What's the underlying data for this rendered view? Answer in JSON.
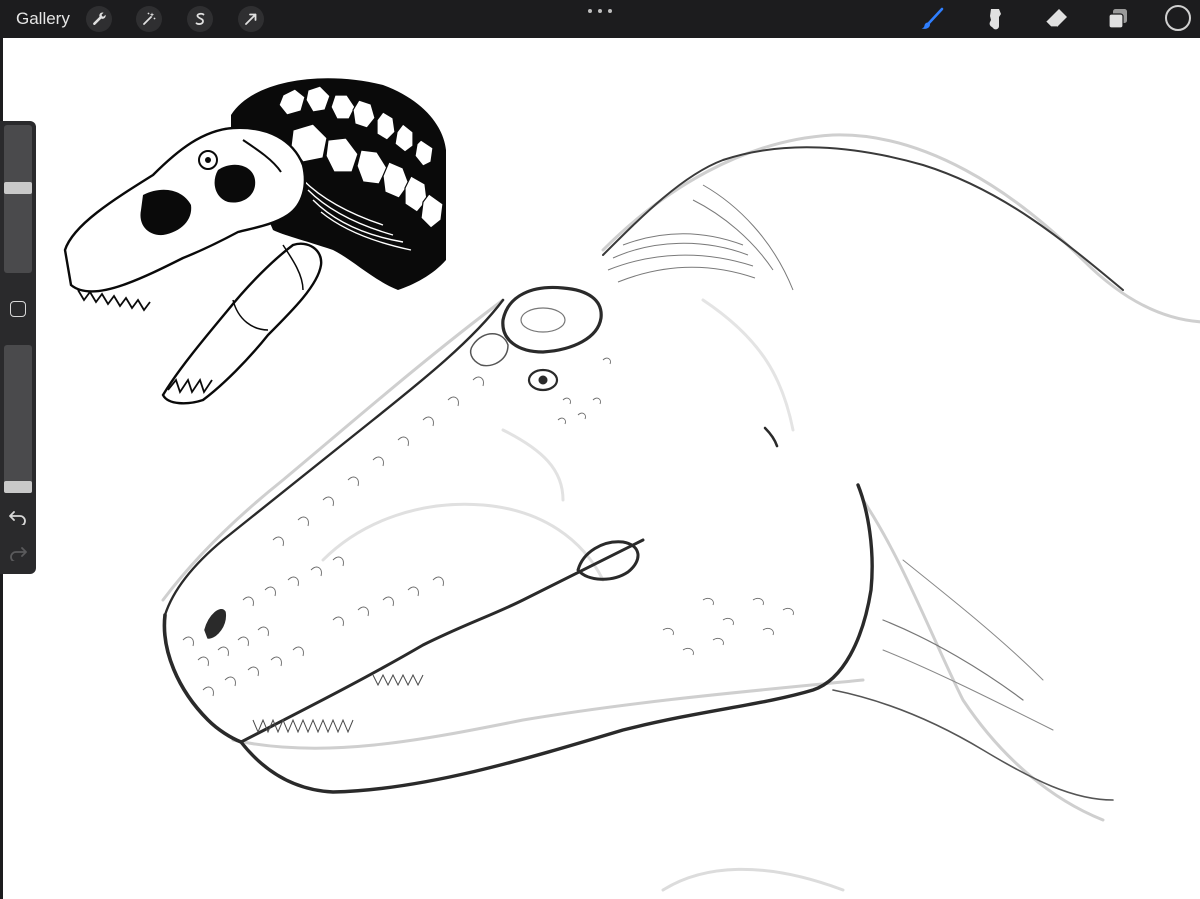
{
  "topbar": {
    "gallery_label": "Gallery",
    "left_tools": [
      {
        "name": "actions",
        "icon": "wrench-icon"
      },
      {
        "name": "adjustments",
        "icon": "magic-wand-icon"
      },
      {
        "name": "selection",
        "icon": "selection-s-icon"
      },
      {
        "name": "transform",
        "icon": "arrow-cursor-icon"
      }
    ],
    "more_menu_icon": "ellipsis-icon",
    "right_tools": [
      {
        "name": "brush",
        "icon": "brush-icon",
        "active": true
      },
      {
        "name": "smudge",
        "icon": "smudge-icon",
        "active": false
      },
      {
        "name": "eraser",
        "icon": "eraser-icon",
        "active": false
      },
      {
        "name": "layers",
        "icon": "layers-icon",
        "active": false
      }
    ],
    "current_color": "#1c1c1e"
  },
  "sidebar": {
    "brush_size_level": 0.58,
    "opacity_level": 0.0,
    "modify_icon": "square-icon",
    "undo_icon": "undo-icon",
    "redo_icon": "redo-icon",
    "redo_enabled": false
  },
  "colors": {
    "toolbar_bg": "#1c1c1e",
    "sidebar_bg": "#2a2a2c",
    "accent_blue": "#2f7fff",
    "canvas_bg": "#ffffff"
  }
}
